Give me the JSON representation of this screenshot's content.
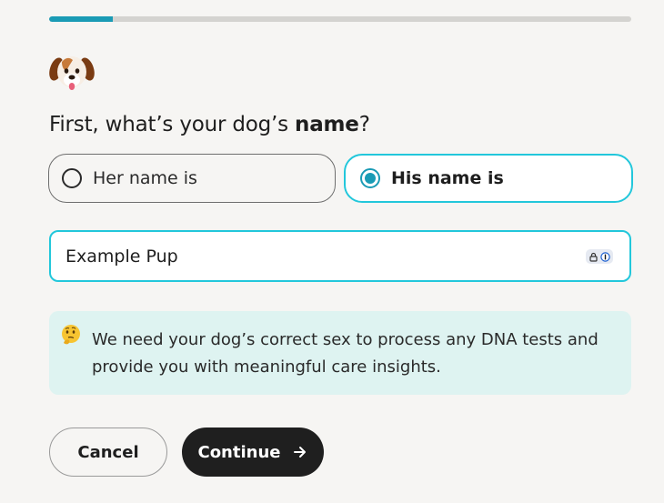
{
  "progress": {
    "fraction": 0.11,
    "fill_color": "#1a9bb5",
    "track_color": "#d4d3d0"
  },
  "header": {
    "emoji_icon": "dog-face-icon"
  },
  "question": {
    "prefix": "First, what’s your dog’s ",
    "emphasis": "name",
    "suffix": "?"
  },
  "sex_options": {
    "selected": "his",
    "items": [
      {
        "id": "her",
        "label": "Her name is"
      },
      {
        "id": "his",
        "label": "His name is"
      }
    ]
  },
  "name_field": {
    "value": "Example Pup",
    "badge_icon": "password-manager-icon"
  },
  "info": {
    "icon": "thinking-face-icon",
    "text": "We need your dog’s correct sex to process any DNA tests and provide you with meaningful care insights."
  },
  "actions": {
    "cancel_label": "Cancel",
    "continue_label": "Continue",
    "continue_icon": "arrow-right-icon"
  },
  "colors": {
    "accent": "#22c7db",
    "primary_button": "#1f1f1f",
    "info_background": "#def3f1"
  }
}
